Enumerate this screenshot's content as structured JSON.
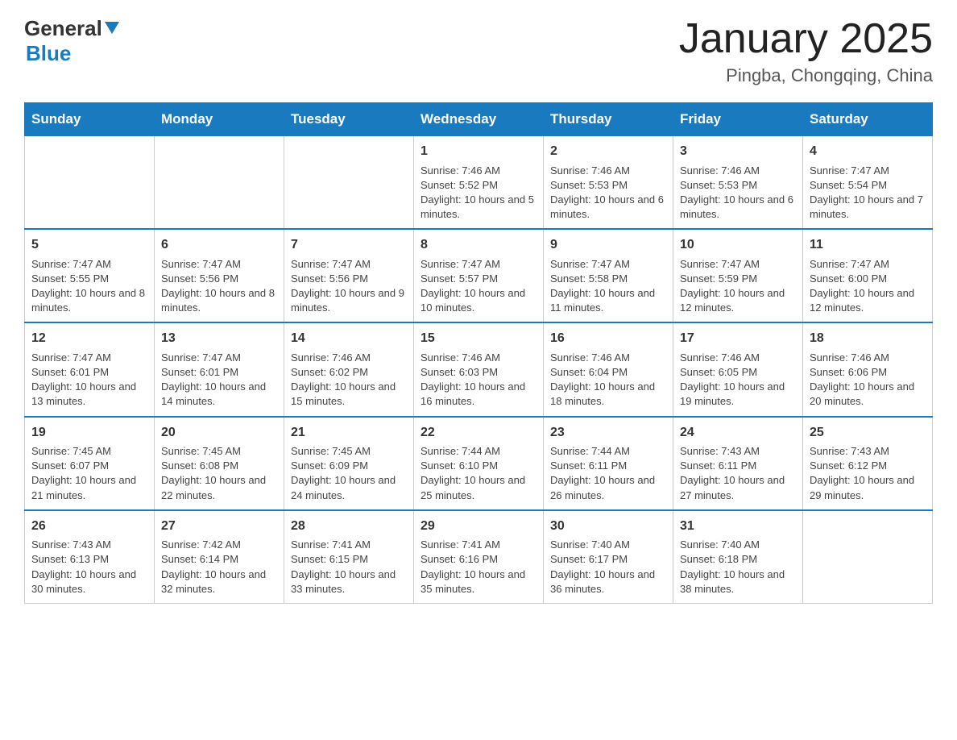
{
  "header": {
    "title": "January 2025",
    "subtitle": "Pingba, Chongqing, China",
    "logo_general": "General",
    "logo_blue": "Blue"
  },
  "columns": [
    "Sunday",
    "Monday",
    "Tuesday",
    "Wednesday",
    "Thursday",
    "Friday",
    "Saturday"
  ],
  "weeks": [
    [
      {
        "day": "",
        "info": ""
      },
      {
        "day": "",
        "info": ""
      },
      {
        "day": "",
        "info": ""
      },
      {
        "day": "1",
        "info": "Sunrise: 7:46 AM\nSunset: 5:52 PM\nDaylight: 10 hours and 5 minutes."
      },
      {
        "day": "2",
        "info": "Sunrise: 7:46 AM\nSunset: 5:53 PM\nDaylight: 10 hours and 6 minutes."
      },
      {
        "day": "3",
        "info": "Sunrise: 7:46 AM\nSunset: 5:53 PM\nDaylight: 10 hours and 6 minutes."
      },
      {
        "day": "4",
        "info": "Sunrise: 7:47 AM\nSunset: 5:54 PM\nDaylight: 10 hours and 7 minutes."
      }
    ],
    [
      {
        "day": "5",
        "info": "Sunrise: 7:47 AM\nSunset: 5:55 PM\nDaylight: 10 hours and 8 minutes."
      },
      {
        "day": "6",
        "info": "Sunrise: 7:47 AM\nSunset: 5:56 PM\nDaylight: 10 hours and 8 minutes."
      },
      {
        "day": "7",
        "info": "Sunrise: 7:47 AM\nSunset: 5:56 PM\nDaylight: 10 hours and 9 minutes."
      },
      {
        "day": "8",
        "info": "Sunrise: 7:47 AM\nSunset: 5:57 PM\nDaylight: 10 hours and 10 minutes."
      },
      {
        "day": "9",
        "info": "Sunrise: 7:47 AM\nSunset: 5:58 PM\nDaylight: 10 hours and 11 minutes."
      },
      {
        "day": "10",
        "info": "Sunrise: 7:47 AM\nSunset: 5:59 PM\nDaylight: 10 hours and 12 minutes."
      },
      {
        "day": "11",
        "info": "Sunrise: 7:47 AM\nSunset: 6:00 PM\nDaylight: 10 hours and 12 minutes."
      }
    ],
    [
      {
        "day": "12",
        "info": "Sunrise: 7:47 AM\nSunset: 6:01 PM\nDaylight: 10 hours and 13 minutes."
      },
      {
        "day": "13",
        "info": "Sunrise: 7:47 AM\nSunset: 6:01 PM\nDaylight: 10 hours and 14 minutes."
      },
      {
        "day": "14",
        "info": "Sunrise: 7:46 AM\nSunset: 6:02 PM\nDaylight: 10 hours and 15 minutes."
      },
      {
        "day": "15",
        "info": "Sunrise: 7:46 AM\nSunset: 6:03 PM\nDaylight: 10 hours and 16 minutes."
      },
      {
        "day": "16",
        "info": "Sunrise: 7:46 AM\nSunset: 6:04 PM\nDaylight: 10 hours and 18 minutes."
      },
      {
        "day": "17",
        "info": "Sunrise: 7:46 AM\nSunset: 6:05 PM\nDaylight: 10 hours and 19 minutes."
      },
      {
        "day": "18",
        "info": "Sunrise: 7:46 AM\nSunset: 6:06 PM\nDaylight: 10 hours and 20 minutes."
      }
    ],
    [
      {
        "day": "19",
        "info": "Sunrise: 7:45 AM\nSunset: 6:07 PM\nDaylight: 10 hours and 21 minutes."
      },
      {
        "day": "20",
        "info": "Sunrise: 7:45 AM\nSunset: 6:08 PM\nDaylight: 10 hours and 22 minutes."
      },
      {
        "day": "21",
        "info": "Sunrise: 7:45 AM\nSunset: 6:09 PM\nDaylight: 10 hours and 24 minutes."
      },
      {
        "day": "22",
        "info": "Sunrise: 7:44 AM\nSunset: 6:10 PM\nDaylight: 10 hours and 25 minutes."
      },
      {
        "day": "23",
        "info": "Sunrise: 7:44 AM\nSunset: 6:11 PM\nDaylight: 10 hours and 26 minutes."
      },
      {
        "day": "24",
        "info": "Sunrise: 7:43 AM\nSunset: 6:11 PM\nDaylight: 10 hours and 27 minutes."
      },
      {
        "day": "25",
        "info": "Sunrise: 7:43 AM\nSunset: 6:12 PM\nDaylight: 10 hours and 29 minutes."
      }
    ],
    [
      {
        "day": "26",
        "info": "Sunrise: 7:43 AM\nSunset: 6:13 PM\nDaylight: 10 hours and 30 minutes."
      },
      {
        "day": "27",
        "info": "Sunrise: 7:42 AM\nSunset: 6:14 PM\nDaylight: 10 hours and 32 minutes."
      },
      {
        "day": "28",
        "info": "Sunrise: 7:41 AM\nSunset: 6:15 PM\nDaylight: 10 hours and 33 minutes."
      },
      {
        "day": "29",
        "info": "Sunrise: 7:41 AM\nSunset: 6:16 PM\nDaylight: 10 hours and 35 minutes."
      },
      {
        "day": "30",
        "info": "Sunrise: 7:40 AM\nSunset: 6:17 PM\nDaylight: 10 hours and 36 minutes."
      },
      {
        "day": "31",
        "info": "Sunrise: 7:40 AM\nSunset: 6:18 PM\nDaylight: 10 hours and 38 minutes."
      },
      {
        "day": "",
        "info": ""
      }
    ]
  ]
}
